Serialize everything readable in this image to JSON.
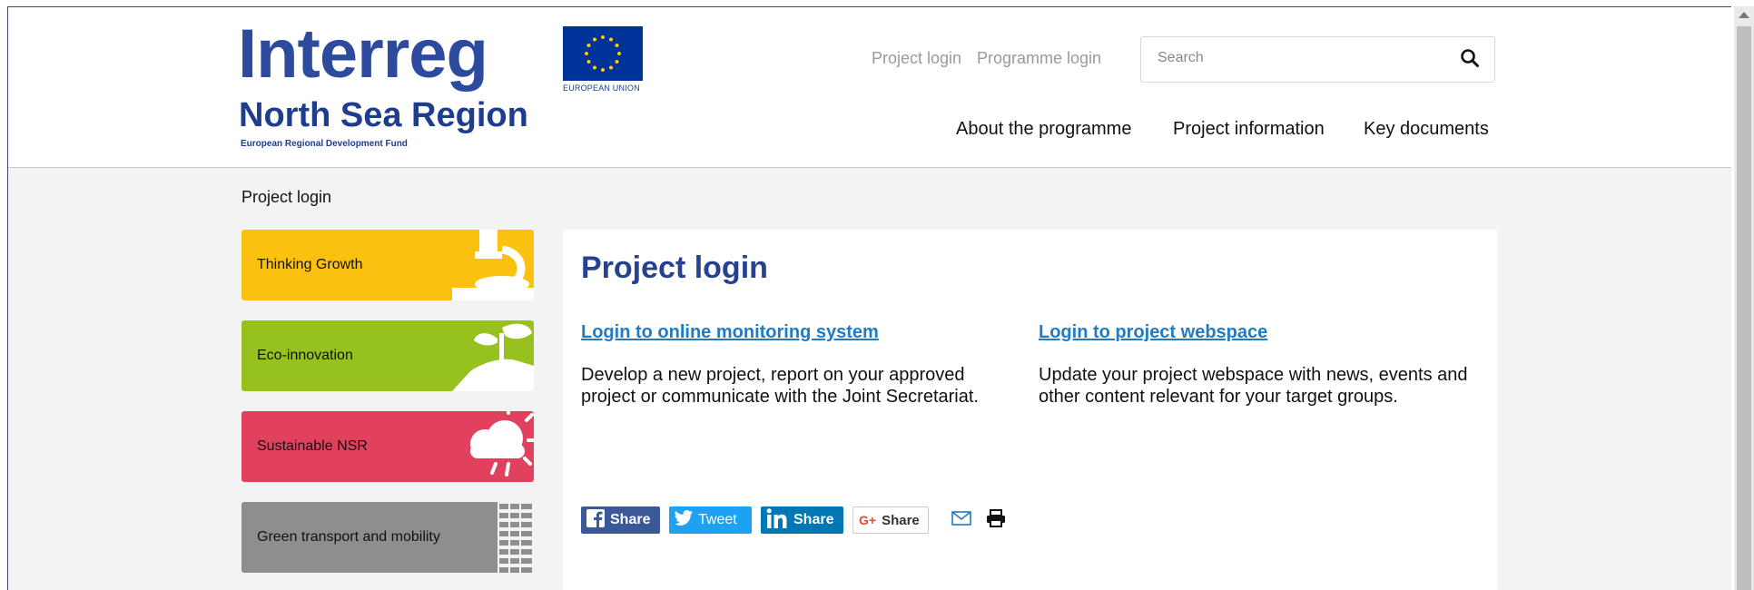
{
  "brand": {
    "name": "Interreg",
    "region": "North Sea Region",
    "fund": "European Regional Development Fund",
    "eu_caption": "EUROPEAN UNION",
    "primary_color": "#2c4a9e"
  },
  "top_links": [
    "Project login",
    "Programme login"
  ],
  "search": {
    "placeholder": "Search",
    "icon": "search-icon"
  },
  "main_nav": [
    "About the programme",
    "Project information",
    "Key documents"
  ],
  "breadcrumb": "Project login",
  "priorities": [
    {
      "label": "Thinking Growth",
      "color": "#fbc110",
      "icon": "microscope-icon"
    },
    {
      "label": "Eco-innovation",
      "color": "#96c11f",
      "icon": "plant-hand-icon"
    },
    {
      "label": "Sustainable NSR",
      "color": "#e2415e",
      "icon": "weather-icon"
    },
    {
      "label": "Green transport and mobility",
      "color": "#8e8e8e",
      "icon": "containers-icon"
    }
  ],
  "panel": {
    "title": "Project login",
    "columns": [
      {
        "link": "Login to online monitoring system",
        "text": "Develop a new project, report on your approved project or communicate with the Joint Secretariat."
      },
      {
        "link": "Login to project webspace",
        "text": "Update your project webspace with news, events and other content relevant for your target groups."
      }
    ],
    "share": {
      "facebook": "Share",
      "twitter": "Tweet",
      "linkedin": "Share",
      "google": "Share"
    }
  }
}
